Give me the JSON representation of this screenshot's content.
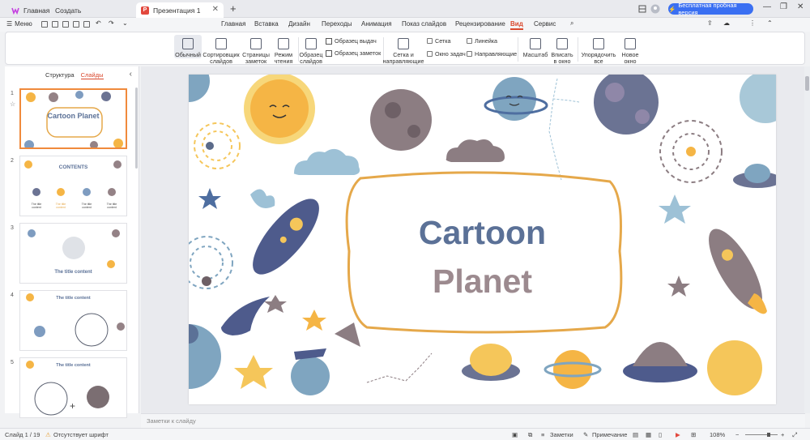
{
  "titlebar": {
    "home": "Главная",
    "create": "Создать",
    "doc_tab": "Презентация 1",
    "trial": "Бесплатная пробная версия"
  },
  "menubar": {
    "menu_label": "Меню",
    "tabs": [
      "Главная",
      "Вставка",
      "Дизайн",
      "Переходы",
      "Анимация",
      "Показ слайдов",
      "Рецензирование",
      "Вид",
      "Сервис"
    ],
    "active_tab": "Вид"
  },
  "ribbon": {
    "normal": "Обычный",
    "sorter": "Сортировщик слайдов",
    "notes_page": "Страницы заметок",
    "reading": "Режим чтения",
    "slide_master": "Образец слайдов",
    "handout_master": "Образец выдач",
    "notes_master": "Образец заметок",
    "grid_guides": "Сетка и направляющие",
    "grid": "Сетка",
    "ruler": "Линейка",
    "task_window": "Окно задач",
    "guides": "Направляющие",
    "zoom": "Масштаб",
    "fit": "Вписать в окно",
    "arrange": "Упорядочить все",
    "new_window": "Новое окно"
  },
  "panel": {
    "tab_structure": "Структура",
    "tab_slides": "Слайды",
    "thumbs": [
      {
        "num": "1",
        "title": "Cartoon Planet"
      },
      {
        "num": "2",
        "title": "CONTENTS",
        "items": [
          "The title content",
          "The title content",
          "The title content",
          "The title content"
        ]
      },
      {
        "num": "3",
        "title": "The title content"
      },
      {
        "num": "4",
        "title": "The title content"
      },
      {
        "num": "5",
        "title": "The title content"
      }
    ]
  },
  "slide": {
    "line1": "Cartoon",
    "line2": "Planet"
  },
  "notes_placeholder": "Заметки к слайду",
  "status": {
    "slide_counter": "Слайд 1 / 19",
    "missing_font": "Отсутствует шрифт",
    "notes": "Заметки",
    "comment": "Примечание",
    "zoom": "108%"
  },
  "colors": {
    "accent": "#d9492e",
    "trial": "#3a6ff2",
    "title_blue": "#5b7197",
    "title_mauve": "#9c8a8f",
    "frame": "#e5a84a",
    "selected_thumb": "#f08a3c"
  }
}
